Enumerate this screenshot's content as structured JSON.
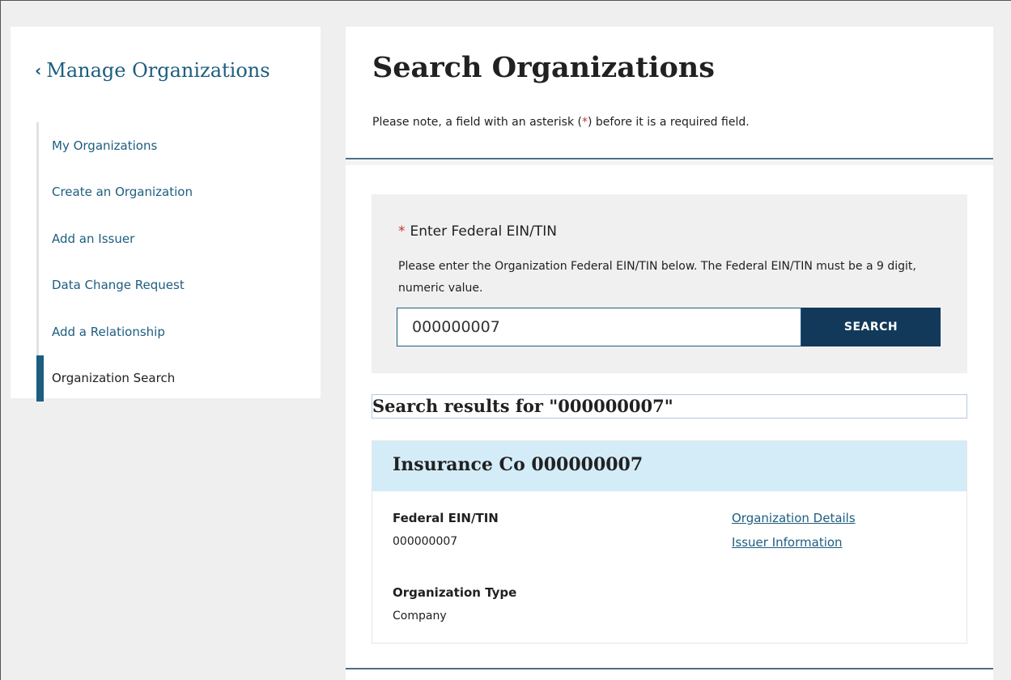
{
  "sidebar": {
    "header": "Manage Organizations",
    "items": [
      {
        "label": "My Organizations"
      },
      {
        "label": "Create an Organization"
      },
      {
        "label": "Add an Issuer"
      },
      {
        "label": "Data Change Request"
      },
      {
        "label": "Add a Relationship"
      },
      {
        "label": "Organization Search",
        "active": true
      }
    ]
  },
  "main": {
    "title": "Search Organizations",
    "note_before": "Please note, a field with an asterisk (",
    "note_asterisk": "*",
    "note_after": ") before it is a required field.",
    "search": {
      "asterisk": "*",
      "label": "Enter Federal EIN/TIN",
      "help": "Please enter the Organization Federal EIN/TIN below. The Federal EIN/TIN must be a 9 digit, numeric value.",
      "input_value": "000000007",
      "button_label": "SEARCH"
    },
    "results_heading": "Search results for \"000000007\"",
    "result": {
      "title": "Insurance Co 000000007",
      "ein_label": "Federal EIN/TIN",
      "ein_value": "000000007",
      "type_label": "Organization Type",
      "type_value": "Company",
      "links": [
        "Organization Details",
        "Issuer Information"
      ]
    }
  },
  "colors": {
    "brand": "#1d5d80",
    "button": "#12395a",
    "card_header": "#d4ecf8",
    "required": "#c0392b"
  }
}
